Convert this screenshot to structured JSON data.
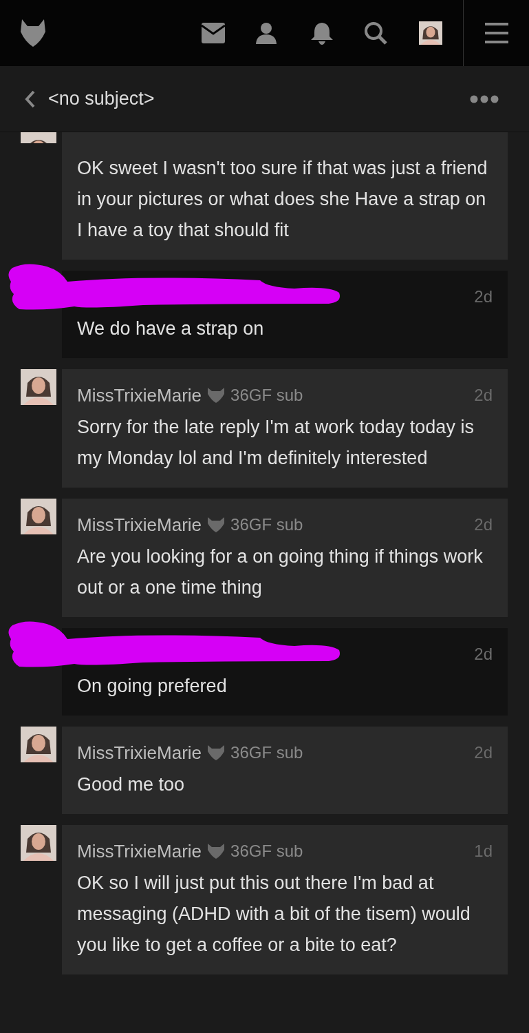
{
  "header": {
    "title": "<no subject>"
  },
  "messages": [
    {
      "kind": "partial",
      "body": "OK sweet I wasn't too sure if that was just a friend in your pictures or what does she Have a strap on I have a toy that should fit"
    },
    {
      "kind": "redacted",
      "time": "2d",
      "body": "We do have a strap on"
    },
    {
      "kind": "incoming",
      "name": "MissTrixieMarie",
      "meta": "36GF sub",
      "time": "2d",
      "body": "Sorry for the late reply I'm at work today today is my Monday lol and I'm definitely interested"
    },
    {
      "kind": "incoming",
      "name": "MissTrixieMarie",
      "meta": "36GF sub",
      "time": "2d",
      "body": "Are you looking for a on going thing if things work out or a one time thing"
    },
    {
      "kind": "redacted",
      "time": "2d",
      "body": "On going prefered"
    },
    {
      "kind": "incoming",
      "name": "MissTrixieMarie",
      "meta": "36GF sub",
      "time": "2d",
      "body": "Good me too"
    },
    {
      "kind": "incoming",
      "name": "MissTrixieMarie",
      "meta": "36GF sub",
      "time": "1d",
      "body": "OK so I will just put this out there I'm bad at messaging (ADHD with a bit of the tisem) would you like to get a coffee or a bite to eat?"
    }
  ]
}
